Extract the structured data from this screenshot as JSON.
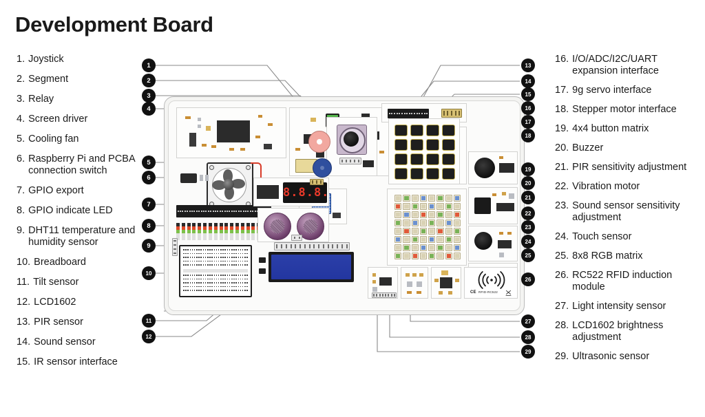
{
  "title": "Development Board",
  "legend_left": [
    {
      "num": "1.",
      "label": "Joystick"
    },
    {
      "num": "2.",
      "label": "Segment"
    },
    {
      "num": "3.",
      "label": "Relay"
    },
    {
      "num": "4.",
      "label": "Screen driver"
    },
    {
      "num": "5.",
      "label": "Cooling fan"
    },
    {
      "num": "6.",
      "label": "Raspberry Pi and PCBA connection switch"
    },
    {
      "num": "7.",
      "label": "GPIO export"
    },
    {
      "num": "8.",
      "label": "GPIO  indicate LED"
    },
    {
      "num": "9.",
      "label": "DHT11 temperature and humidity sensor"
    },
    {
      "num": "10.",
      "label": "Breadboard"
    },
    {
      "num": "11.",
      "label": "Tilt sensor"
    },
    {
      "num": "12.",
      "label": "LCD1602"
    },
    {
      "num": "13.",
      "label": "PIR sensor"
    },
    {
      "num": "14.",
      "label": "Sound sensor"
    },
    {
      "num": "15.",
      "label": "IR sensor interface"
    }
  ],
  "legend_right": [
    {
      "num": "16.",
      "label": "I/O/ADC/I2C/UART expansion interface"
    },
    {
      "num": "17.",
      "label": "9g servo interface"
    },
    {
      "num": "18.",
      "label": "Stepper motor interface"
    },
    {
      "num": "19.",
      "label": "4x4 button matrix"
    },
    {
      "num": "20.",
      "label": "Buzzer"
    },
    {
      "num": "21.",
      "label": "PIR sensitivity adjustment"
    },
    {
      "num": "22.",
      "label": "Vibration motor"
    },
    {
      "num": "23.",
      "label": "Sound sensor sensitivity adjustment"
    },
    {
      "num": "24.",
      "label": "Touch sensor"
    },
    {
      "num": "25.",
      "label": "8x8 RGB matrix"
    },
    {
      "num": "26.",
      "label": "RC522 RFID induction module"
    },
    {
      "num": "27.",
      "label": "Light intensity sensor"
    },
    {
      "num": "28.",
      "label": "LCD1602 brightness adjustment"
    },
    {
      "num": "29.",
      "label": "Ultrasonic sensor"
    }
  ],
  "callouts_left": [
    "1",
    "2",
    "3",
    "4",
    "5",
    "6",
    "7",
    "8",
    "9",
    "10",
    "11",
    "12"
  ],
  "callouts_right": [
    "13",
    "14",
    "15",
    "16",
    "17",
    "18",
    "19",
    "20",
    "21",
    "22",
    "23",
    "24",
    "25",
    "26",
    "27",
    "28",
    "29"
  ],
  "board": {
    "seg_display_value": "8.8.8.8.",
    "rfid_label": "RFID-RC522",
    "rfid_ce_mark": "CE"
  },
  "colors": {
    "callout_bg": "#111111",
    "callout_text": "#ffffff",
    "leader_line": "#8a8a8a",
    "board_bg": "#f4f4f2",
    "text": "#1a1a1a",
    "led_red": "#e04a2a",
    "led_green": "#7ec04a",
    "lcd_blue": "#2b3fa8",
    "segment_red": "#e8392a"
  }
}
